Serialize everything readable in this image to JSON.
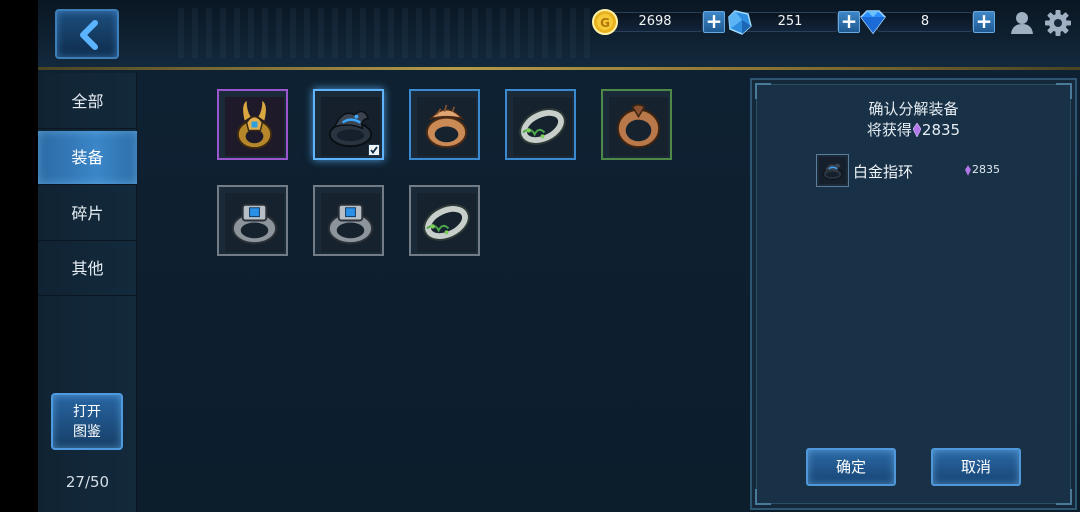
{
  "header": {
    "gold": "2698",
    "crystal": "251",
    "diamond": "8",
    "back_icon": "chevron-left-icon",
    "user_icon": "user-icon",
    "settings_icon": "gear-icon"
  },
  "sidebar": {
    "tabs": [
      {
        "label": "全部",
        "active": false
      },
      {
        "label": "装备",
        "active": true
      },
      {
        "label": "碎片",
        "active": false
      },
      {
        "label": "其他",
        "active": false
      }
    ],
    "open_book_line1": "打开",
    "open_book_line2": "图鉴",
    "capacity": "27/50"
  },
  "grid": {
    "items": [
      {
        "icon": "gold-horned-ring-icon",
        "rarity": "purple",
        "selected": false
      },
      {
        "icon": "black-dragon-ring-icon",
        "rarity": "blue",
        "selected": true
      },
      {
        "icon": "copper-shell-ring-icon",
        "rarity": "blue",
        "selected": false
      },
      {
        "icon": "silver-vine-ring-icon",
        "rarity": "blue",
        "selected": false
      },
      {
        "icon": "bronze-ring-icon",
        "rarity": "green",
        "selected": false
      },
      {
        "icon": "blue-gem-ring-icon",
        "rarity": "gray",
        "selected": false
      },
      {
        "icon": "blue-gem-ring-icon",
        "rarity": "gray",
        "selected": false
      },
      {
        "icon": "silver-vine-ring-icon",
        "rarity": "gray",
        "selected": false
      }
    ]
  },
  "panel": {
    "title": "确认分解装备",
    "gain_label": "将获得",
    "gain_value": "2835",
    "list": [
      {
        "name": "白金指环",
        "value": "2835",
        "icon": "black-dragon-ring-icon"
      }
    ],
    "confirm_label": "确定",
    "cancel_label": "取消"
  },
  "colors": {
    "accent_blue": "#3b86c8",
    "gold_line": "#b59a4a",
    "purple_rarity": "#9a55cf",
    "blue_rarity": "#3a8ad0",
    "green_rarity": "#4e8a46",
    "gem_purple": "#b276e8"
  }
}
